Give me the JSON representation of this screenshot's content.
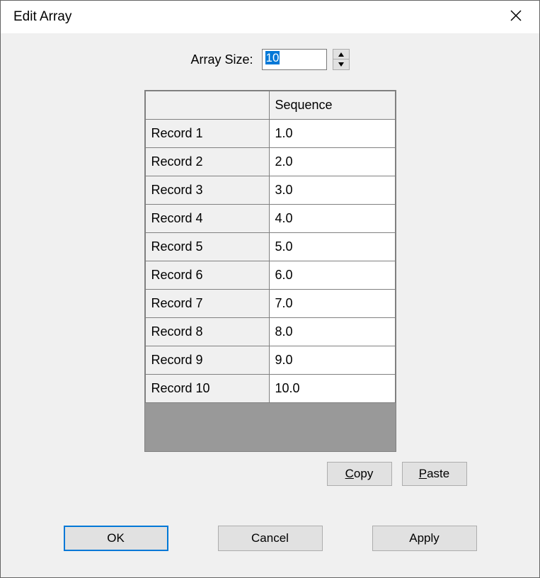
{
  "title": "Edit Array",
  "arraySize": {
    "label": "Array Size:",
    "value": "10"
  },
  "table": {
    "header": "Sequence",
    "rows": [
      {
        "label": "Record 1",
        "value": "1.0"
      },
      {
        "label": "Record 2",
        "value": "2.0"
      },
      {
        "label": "Record 3",
        "value": "3.0"
      },
      {
        "label": "Record 4",
        "value": "4.0"
      },
      {
        "label": "Record 5",
        "value": "5.0"
      },
      {
        "label": "Record 6",
        "value": "6.0"
      },
      {
        "label": "Record 7",
        "value": "7.0"
      },
      {
        "label": "Record 8",
        "value": "8.0"
      },
      {
        "label": "Record 9",
        "value": "9.0"
      },
      {
        "label": "Record 10",
        "value": "10.0"
      }
    ]
  },
  "buttons": {
    "copy": "Copy",
    "paste": "Paste",
    "ok": "OK",
    "cancel": "Cancel",
    "apply": "Apply"
  }
}
